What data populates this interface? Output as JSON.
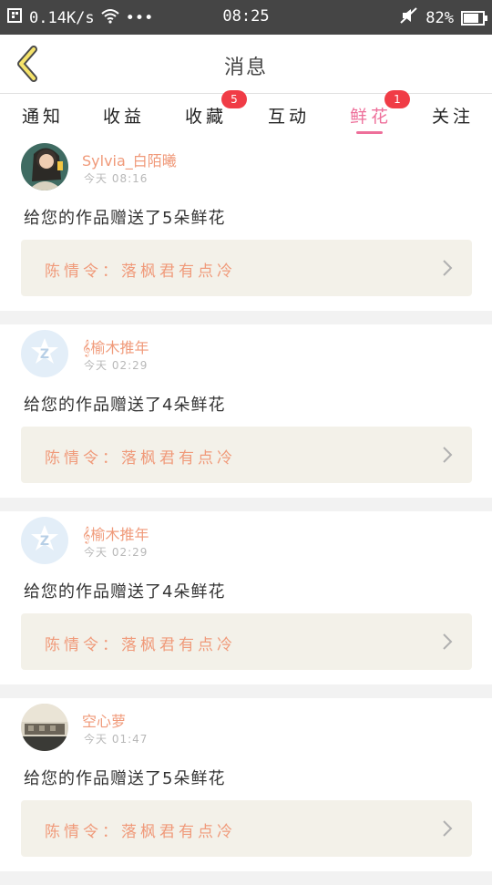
{
  "status": {
    "network_speed": "0.14K/s",
    "more": "•••",
    "time": "08:25",
    "battery": "82%",
    "battery_level": 0.82
  },
  "header": {
    "title": "消息"
  },
  "tabs": [
    {
      "label": "通知",
      "active": false,
      "badge": ""
    },
    {
      "label": "收益",
      "active": false,
      "badge": ""
    },
    {
      "label": "收藏",
      "active": false,
      "badge": "5"
    },
    {
      "label": "互动",
      "active": false,
      "badge": ""
    },
    {
      "label": "鲜花",
      "active": true,
      "badge": "1"
    },
    {
      "label": "关注",
      "active": false,
      "badge": ""
    }
  ],
  "feed": [
    {
      "name": "Sylvia_白陌曦",
      "time": "今天 08:16",
      "message": "给您的作品赠送了5朵鲜花",
      "work": "陈情令：落枫君有点冷",
      "avatar": "photo-portrait"
    },
    {
      "name": "𝄞榆木推年",
      "time": "今天 02:29",
      "message": "给您的作品赠送了4朵鲜花",
      "work": "陈情令：落枫君有点冷",
      "avatar": "default-z-avatar"
    },
    {
      "name": "𝄞榆木推年",
      "time": "今天 02:29",
      "message": "给您的作品赠送了4朵鲜花",
      "work": "陈情令：落枫君有点冷",
      "avatar": "default-z-avatar"
    },
    {
      "name": "空心萝",
      "time": "今天 01:47",
      "message": "给您的作品赠送了5朵鲜花",
      "work": "陈情令：落枫君有点冷",
      "avatar": "photo-scene"
    }
  ],
  "colors": {
    "accent": "#ee6f9a",
    "name": "#f09a7a",
    "badge": "#f03c46",
    "status_bar": "#454545"
  }
}
